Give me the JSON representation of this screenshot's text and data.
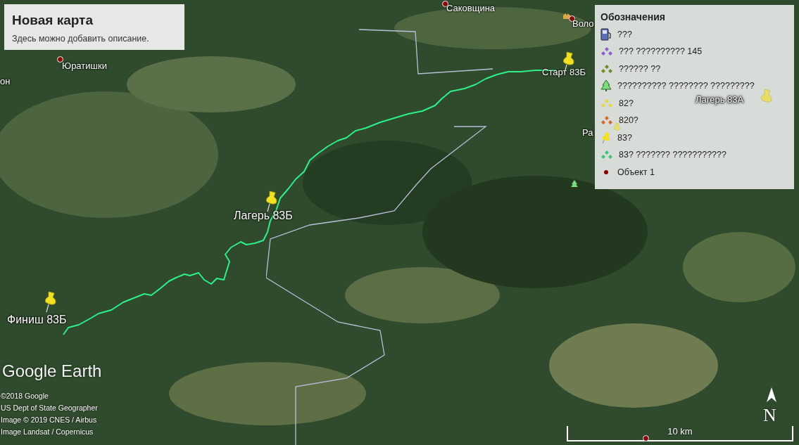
{
  "title_card": {
    "title": "Новая карта",
    "description": "Здесь можно добавить описание."
  },
  "legend": {
    "title": "Обозначения",
    "items": [
      {
        "kind": "fuel",
        "color": "#5b6fb8",
        "label": "???"
      },
      {
        "kind": "nodes",
        "color": "#8e5bd0",
        "label": "??? ?????????? 145"
      },
      {
        "kind": "nodes",
        "color": "#6b8e23",
        "label": "?????? ??"
      },
      {
        "kind": "tree",
        "color": "#7ddc7d",
        "label": "?????????? ???????? ?????????"
      },
      {
        "kind": "nodes",
        "color": "#e8d640",
        "label": "82?"
      },
      {
        "kind": "nodes",
        "color": "#d9692a",
        "label": "820?"
      },
      {
        "kind": "pin",
        "color": "#f2e022",
        "label": "83?"
      },
      {
        "kind": "nodes",
        "color": "#3cc47a",
        "label": "83? ??????? ???????????"
      },
      {
        "kind": "dot",
        "color": "#8b0000",
        "label": "Объект 1"
      }
    ]
  },
  "map": {
    "places": [
      {
        "kind": "town",
        "label": "Юратишки"
      },
      {
        "kind": "town",
        "label": "Саковщина"
      },
      {
        "kind": "town",
        "label": "Воло"
      },
      {
        "kind": "plain",
        "label": "он"
      },
      {
        "kind": "pin",
        "label": "Старт 83Б"
      },
      {
        "kind": "pin",
        "label": "Лагерь 83Б"
      },
      {
        "kind": "pin",
        "label": "Финиш 83Б"
      },
      {
        "kind": "pin",
        "label": "Лагерь 83А"
      },
      {
        "kind": "pin",
        "label": "Ра"
      }
    ]
  },
  "logo": "Google Earth",
  "credits": [
    "©2018 Google",
    "US Dept of State Geographer",
    "Image © 2019 CNES / Airbus",
    "Image Landsat / Copernicus"
  ],
  "scale": "10 km",
  "compass": "N"
}
